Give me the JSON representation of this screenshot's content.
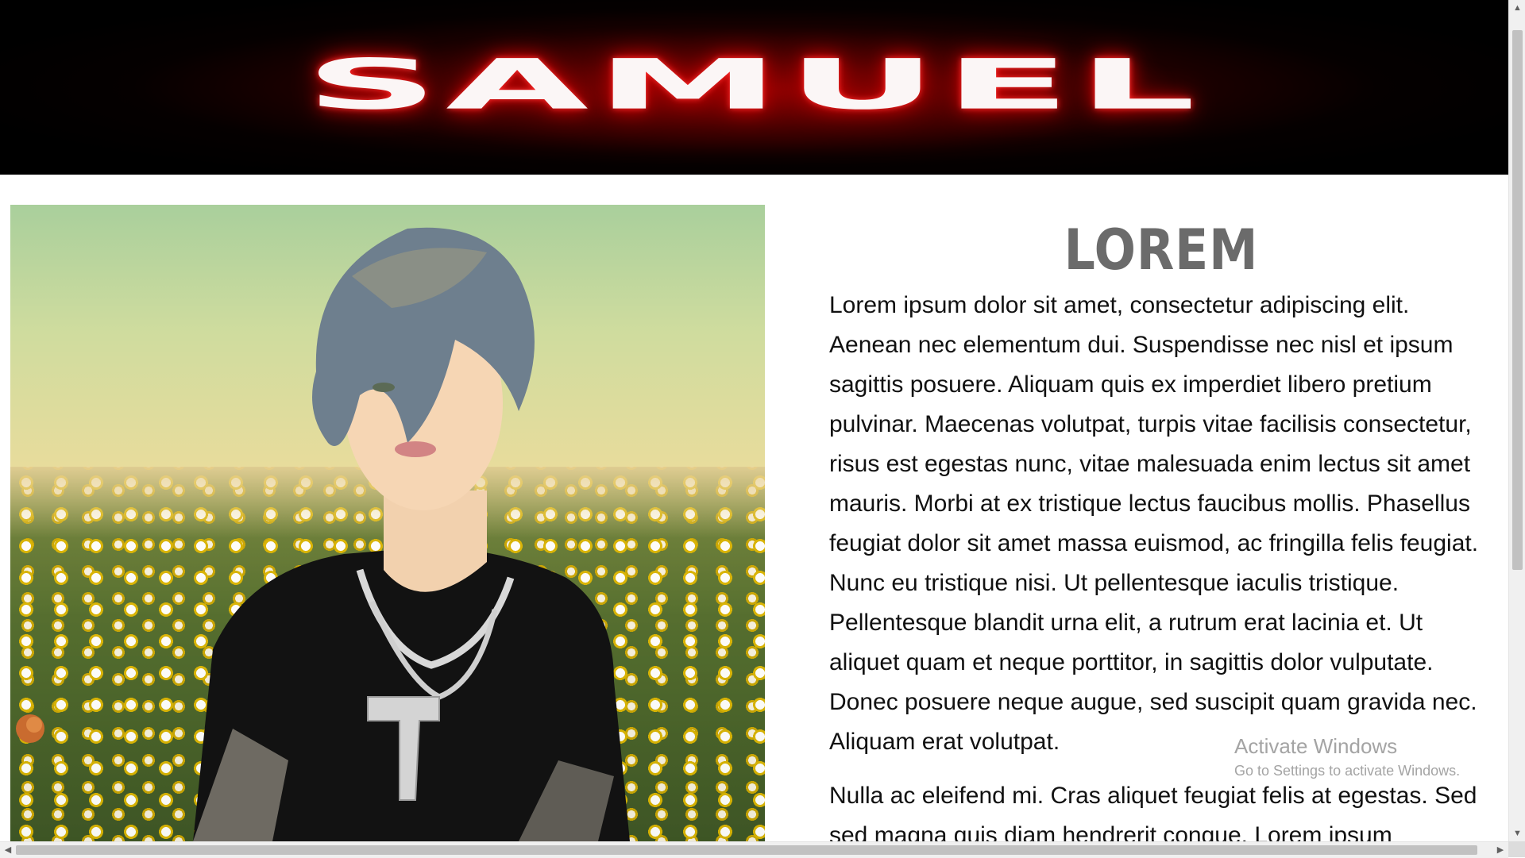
{
  "header": {
    "logo_text": "SAMUEL"
  },
  "photo": {
    "subject": "3D avatar of a young man with grey-blue hair in a black t-shirt and silver chain necklace with gun pendant, standing in a daisy field"
  },
  "content": {
    "title": "LOREM",
    "paragraphs": [
      "Lorem ipsum dolor sit amet, consectetur adipiscing elit. Aenean nec elementum dui. Suspendisse nec nisl et ipsum sagittis posuere. Aliquam quis ex imperdiet libero pretium pulvinar. Maecenas volutpat, turpis vitae facilisis consectetur, risus est egestas nunc, vitae malesuada enim lectus sit amet mauris. Morbi at ex tristique lectus faucibus mollis. Phasellus feugiat dolor sit amet massa euismod, ac fringilla felis feugiat. Nunc eu tristique nisi. Ut pellentesque iaculis tristique. Pellentesque blandit urna elit, a rutrum erat lacinia et. Ut aliquet quam et neque porttitor, in sagittis dolor vulputate. Donec posuere neque augue, sed suscipit quam gravida nec. Aliquam erat volutpat.",
      "Nulla ac eleifend mi. Cras aliquet feugiat felis at egestas. Sed sed magna quis diam hendrerit congue. Lorem ipsum"
    ]
  },
  "watermark": {
    "title": "Activate Windows",
    "subtitle": "Go to Settings to activate Windows."
  },
  "scrollbars": {
    "up_arrow": "▲",
    "down_arrow": "▼",
    "left_arrow": "◀",
    "right_arrow": "▶"
  },
  "colors": {
    "banner_bg": "#000000",
    "banner_glow": "#c00000",
    "logo_text": "#fbf6f6",
    "title_gray": "#6b6b6b",
    "body_text": "#111111"
  },
  "icons": [
    "scroll-up-arrow-icon",
    "scroll-down-arrow-icon",
    "scroll-left-arrow-icon",
    "scroll-right-arrow-icon"
  ]
}
